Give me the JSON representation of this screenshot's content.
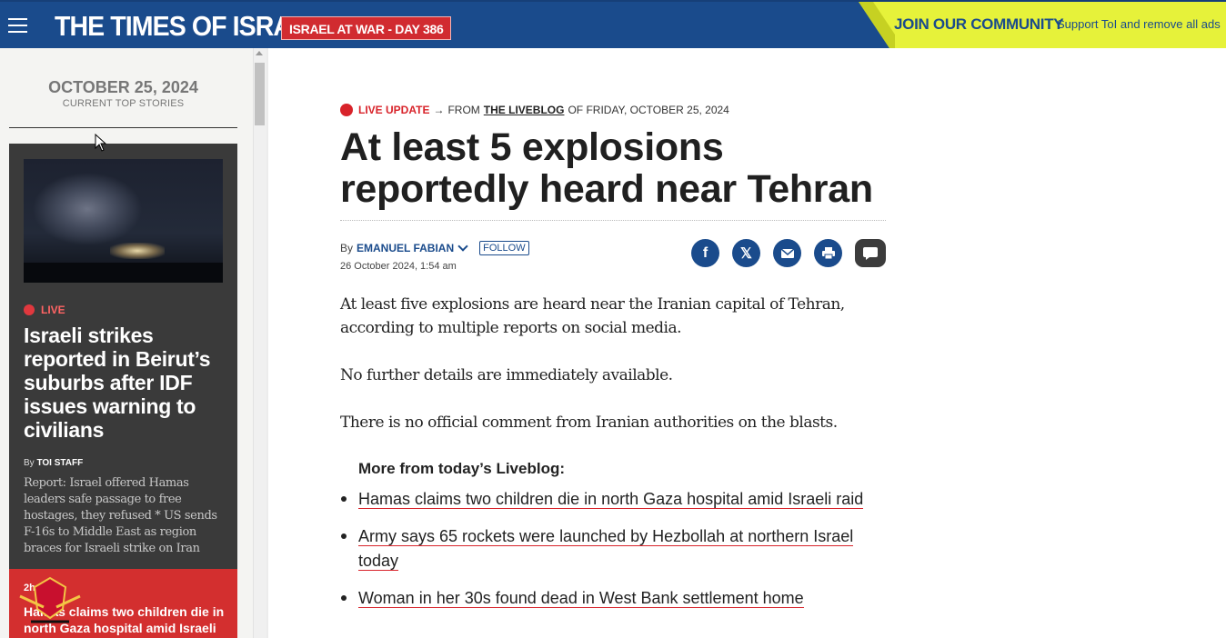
{
  "header": {
    "logo": "THE TIMES OF ISRAEL",
    "war_badge": "ISRAEL AT WAR - DAY 386",
    "join_title": "JOIN OUR COMMUNITY",
    "join_sub": "Support ToI and remove all ads",
    "colors": {
      "header_bg": "#1a4b8c",
      "badge_bg": "#d12b30",
      "join_bg": "#e6f23a"
    }
  },
  "sidebar": {
    "date": "OCTOBER 25, 2024",
    "subtitle": "CURRENT TOP STORIES",
    "card": {
      "live_label": "LIVE",
      "title": "Israeli strikes reported in Beirut’s suburbs after IDF issues warning to civilians",
      "by_prefix": "By",
      "author": "TOI STAFF",
      "excerpt": "Report: Israel offered Hamas leaders safe passage to free hostages, they refused * US sends F-16s to Middle East as region braces for Israeli strike on Iran"
    },
    "red_card": {
      "time": "2h",
      "title": "Hamas claims two children die in north Gaza hospital amid Israeli"
    }
  },
  "article": {
    "live_update": "LIVE UPDATE",
    "arrow": "→",
    "from": "FROM",
    "liveblog": "THE LIVEBLOG",
    "of_date": "OF FRIDAY, OCTOBER 25, 2024",
    "headline": "At least 5 explosions reportedly heard near Tehran",
    "by_prefix": "By",
    "author": "EMANUEL FABIAN",
    "follow": "FOLLOW",
    "pubdate": "26 October 2024, 1:54 am",
    "share_icons": [
      "facebook-icon",
      "x-icon",
      "email-icon",
      "print-icon",
      "comment-icon"
    ],
    "paragraphs": [
      "At least five explosions are heard near the Iranian capital of Tehran, according to multiple reports on social media.",
      "No further details are immediately available.",
      "There is no official comment from Iranian authorities on the blasts."
    ],
    "more_title": "More from today’s Liveblog:",
    "more_links": [
      "Hamas claims two children die in north Gaza hospital amid Israeli raid",
      "Army says 65 rockets were launched by Hezbollah at northern Israel today",
      "Woman in her 30s found dead in West Bank settlement home"
    ]
  }
}
